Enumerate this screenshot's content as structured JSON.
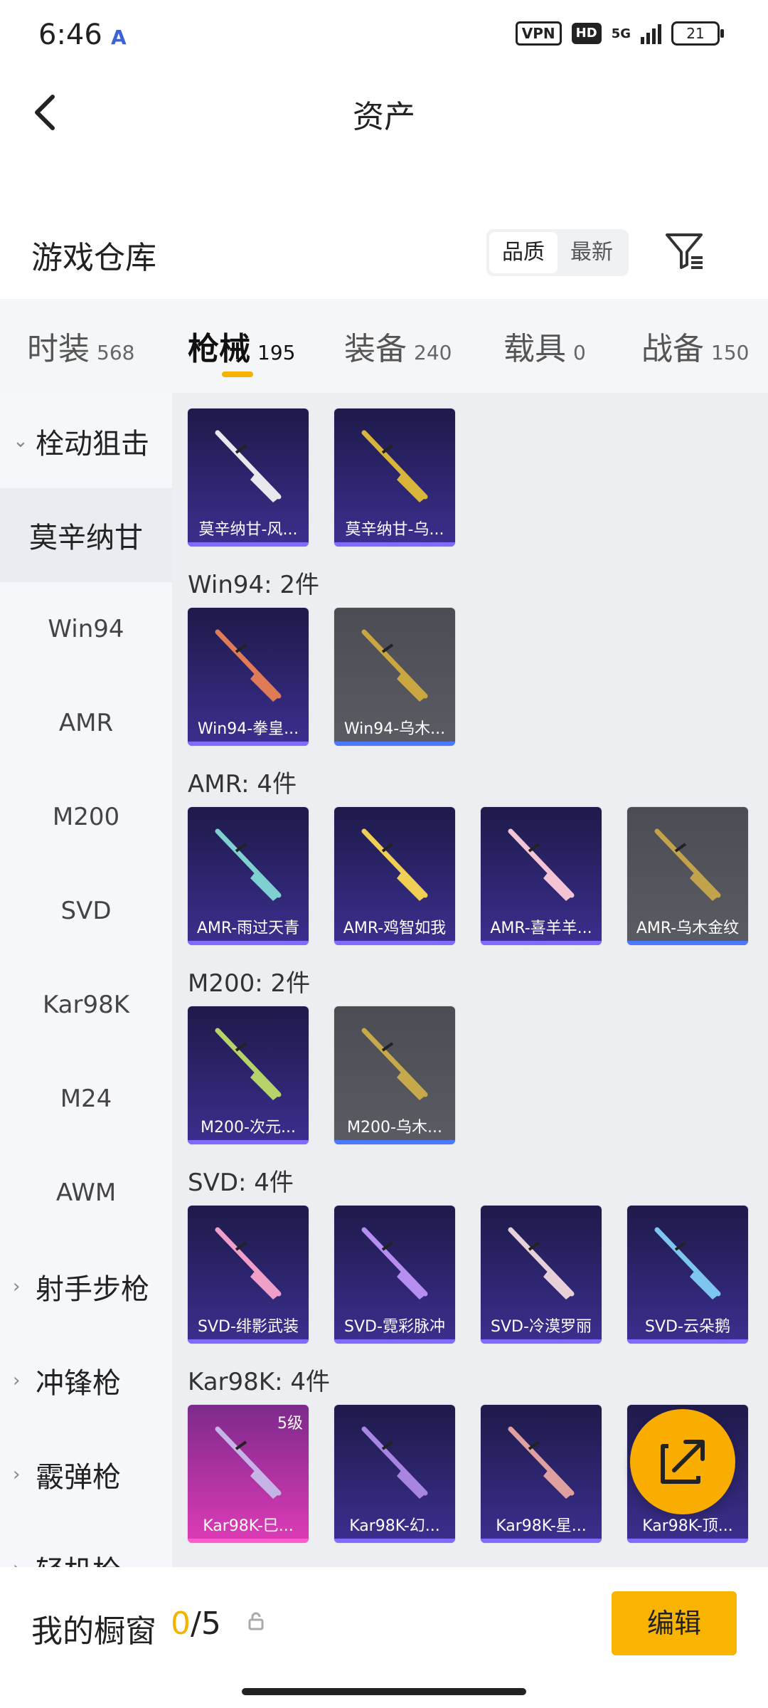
{
  "status": {
    "time": "6:46",
    "vpn": "VPN",
    "hd": "HD",
    "network": "5G",
    "battery": "21"
  },
  "header": {
    "title": "资产"
  },
  "warehouse": {
    "title": "游戏仓库",
    "sort_options": [
      "品质",
      "最新"
    ],
    "active_sort": "品质"
  },
  "tabs": [
    {
      "label": "时装",
      "count": "568"
    },
    {
      "label": "枪械",
      "count": "195"
    },
    {
      "label": "装备",
      "count": "240"
    },
    {
      "label": "载具",
      "count": "0"
    },
    {
      "label": "战备",
      "count": "150"
    }
  ],
  "active_tab": "枪械",
  "sidebar": {
    "group_expanded": "栓动狙击",
    "items": [
      "莫辛纳甘",
      "Win94",
      "AMR",
      "M200",
      "SVD",
      "Kar98K",
      "M24",
      "AWM"
    ],
    "active_item": "莫辛纳甘",
    "groups_collapsed": [
      "射手步枪",
      "冲锋枪",
      "霰弹枪",
      "轻机枪"
    ]
  },
  "sections": [
    {
      "label": "",
      "items": [
        {
          "name": "莫辛纳甘-风...",
          "style": "purple"
        },
        {
          "name": "莫辛纳甘-乌...",
          "style": "purple"
        }
      ]
    },
    {
      "label": "Win94: 2件",
      "items": [
        {
          "name": "Win94-拳皇...",
          "style": "purple"
        },
        {
          "name": "Win94-乌木...",
          "style": "gray"
        }
      ]
    },
    {
      "label": "AMR: 4件",
      "items": [
        {
          "name": "AMR-雨过天青",
          "style": "purple"
        },
        {
          "name": "AMR-鸡智如我",
          "style": "purple"
        },
        {
          "name": "AMR-喜羊羊...",
          "style": "purple"
        },
        {
          "name": "AMR-乌木金纹",
          "style": "gray"
        }
      ]
    },
    {
      "label": "M200: 2件",
      "items": [
        {
          "name": "M200-次元...",
          "style": "purple"
        },
        {
          "name": "M200-乌木...",
          "style": "gray"
        }
      ]
    },
    {
      "label": "SVD: 4件",
      "items": [
        {
          "name": "SVD-绯影武装",
          "style": "purple"
        },
        {
          "name": "SVD-霓彩脉冲",
          "style": "purple"
        },
        {
          "name": "SVD-冷漠罗丽",
          "style": "purple"
        },
        {
          "name": "SVD-云朵鹅",
          "style": "purple"
        }
      ]
    },
    {
      "label": "Kar98K: 4件",
      "items": [
        {
          "name": "Kar98K-巳...",
          "style": "pink",
          "badge": "5级"
        },
        {
          "name": "Kar98K-幻...",
          "style": "purple"
        },
        {
          "name": "Kar98K-星...",
          "style": "purple"
        },
        {
          "name": "Kar98K-顶...",
          "style": "purple"
        }
      ]
    }
  ],
  "bottom": {
    "window_label": "我的橱窗",
    "window_current": "0",
    "window_sep": "/",
    "window_max": "5",
    "edit_label": "编辑"
  },
  "colors": {
    "accent": "#f8b400",
    "card_purple": "#2e2670",
    "card_gray": "#55565d",
    "card_pink": "#d13db2"
  }
}
